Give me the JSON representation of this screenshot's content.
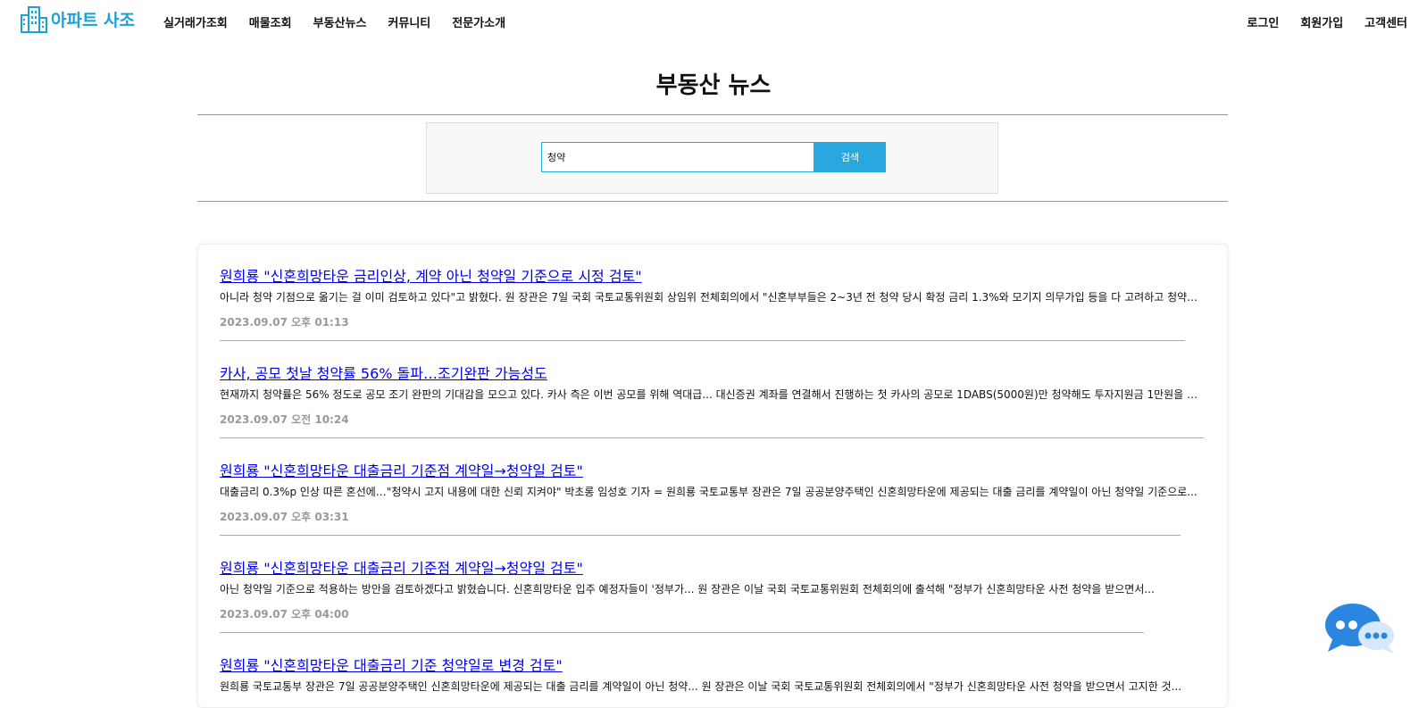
{
  "header": {
    "logo_text": "아파트 사조",
    "brand_color": "#1da0d8",
    "nav": [
      "실거래가조회",
      "매물조회",
      "부동산뉴스",
      "커뮤니티",
      "전문가소개"
    ],
    "util": [
      "로그인",
      "회원가입",
      "고객센터"
    ]
  },
  "page": {
    "title": "부동산 뉴스"
  },
  "search": {
    "value": "청약",
    "button_label": "검색",
    "accent_color": "#29a7df"
  },
  "news": [
    {
      "title": "원희룡 \"신혼희망타운 금리인상, 계약 아닌 청약일 기준으로 시정 검토\"",
      "summary": "아니라 청약 기점으로 옮기는 걸 이미 검토하고 있다\"고 밝혔다. 원 장관은 7일 국회 국토교통위원회 상임위 전체회의에서 \"신혼부부들은 2~3년 전 청약 당시 확정 금리 1.3%와 모기지 의무가입 등을 다 고려하고 청약을...",
      "date": "2023.09.07 오후 01:13"
    },
    {
      "title": "카사, 공모 첫날 청약률 56% 돌파…조기완판 가능성도",
      "summary": "현재까지 청약률은 56% 정도로 공모 조기 완판의 기대감을 모으고 있다. 카사 측은 이번 공모를 위해 역대급... 대신증권 계좌를 연결해서 진행하는 첫 카사의 공모로 1DABS(5000원)만 청약해도 투자지원금 1만원을 선착순...",
      "date": "2023.09.07 오전 10:24"
    },
    {
      "title": "원희룡 \"신혼희망타운 대출금리 기준점 계약일→청약일 검토\"",
      "summary": "대출금리 0.3%p 인상 따른 혼선에…\"청약시 고지 내용에 대한 신뢰 지켜야\" 박초롱 임성호 기자 = 원희룡 국토교통부 장관은 7일 공공분양주택인 신혼희망타운에 제공되는 대출 금리를 계약일이 아닌 청약일 기준으로...",
      "date": "2023.09.07 오후 03:31"
    },
    {
      "title": "원희룡 \"신혼희망타운 대출금리 기준점 계약일→청약일 검토\"",
      "summary": "아닌 청약일 기준으로 적용하는 방안을 검토하겠다고 밝혔습니다. 신혼희망타운 입주 예정자들이 '정부가... 원 장관은 이날 국회 국토교통위원회 전체회의에 출석해 \"정부가 신혼희망타운 사전 청약을 받으면서...",
      "date": "2023.09.07 오후 04:00"
    },
    {
      "title": "원희룡 \"신혼희망타운 대출금리 기준 청약일로 변경 검토\"",
      "summary": "원희룡 국토교통부 장관은 7일 공공분양주택인 신혼희망타운에 제공되는 대출 금리를 계약일이 아닌 청약... 원 장관은 이날 국회 국토교통위원회 전체회의에서 \"정부가 신혼희망타운 사전 청약을 받으면서 고지한 것...",
      "date": ""
    }
  ]
}
